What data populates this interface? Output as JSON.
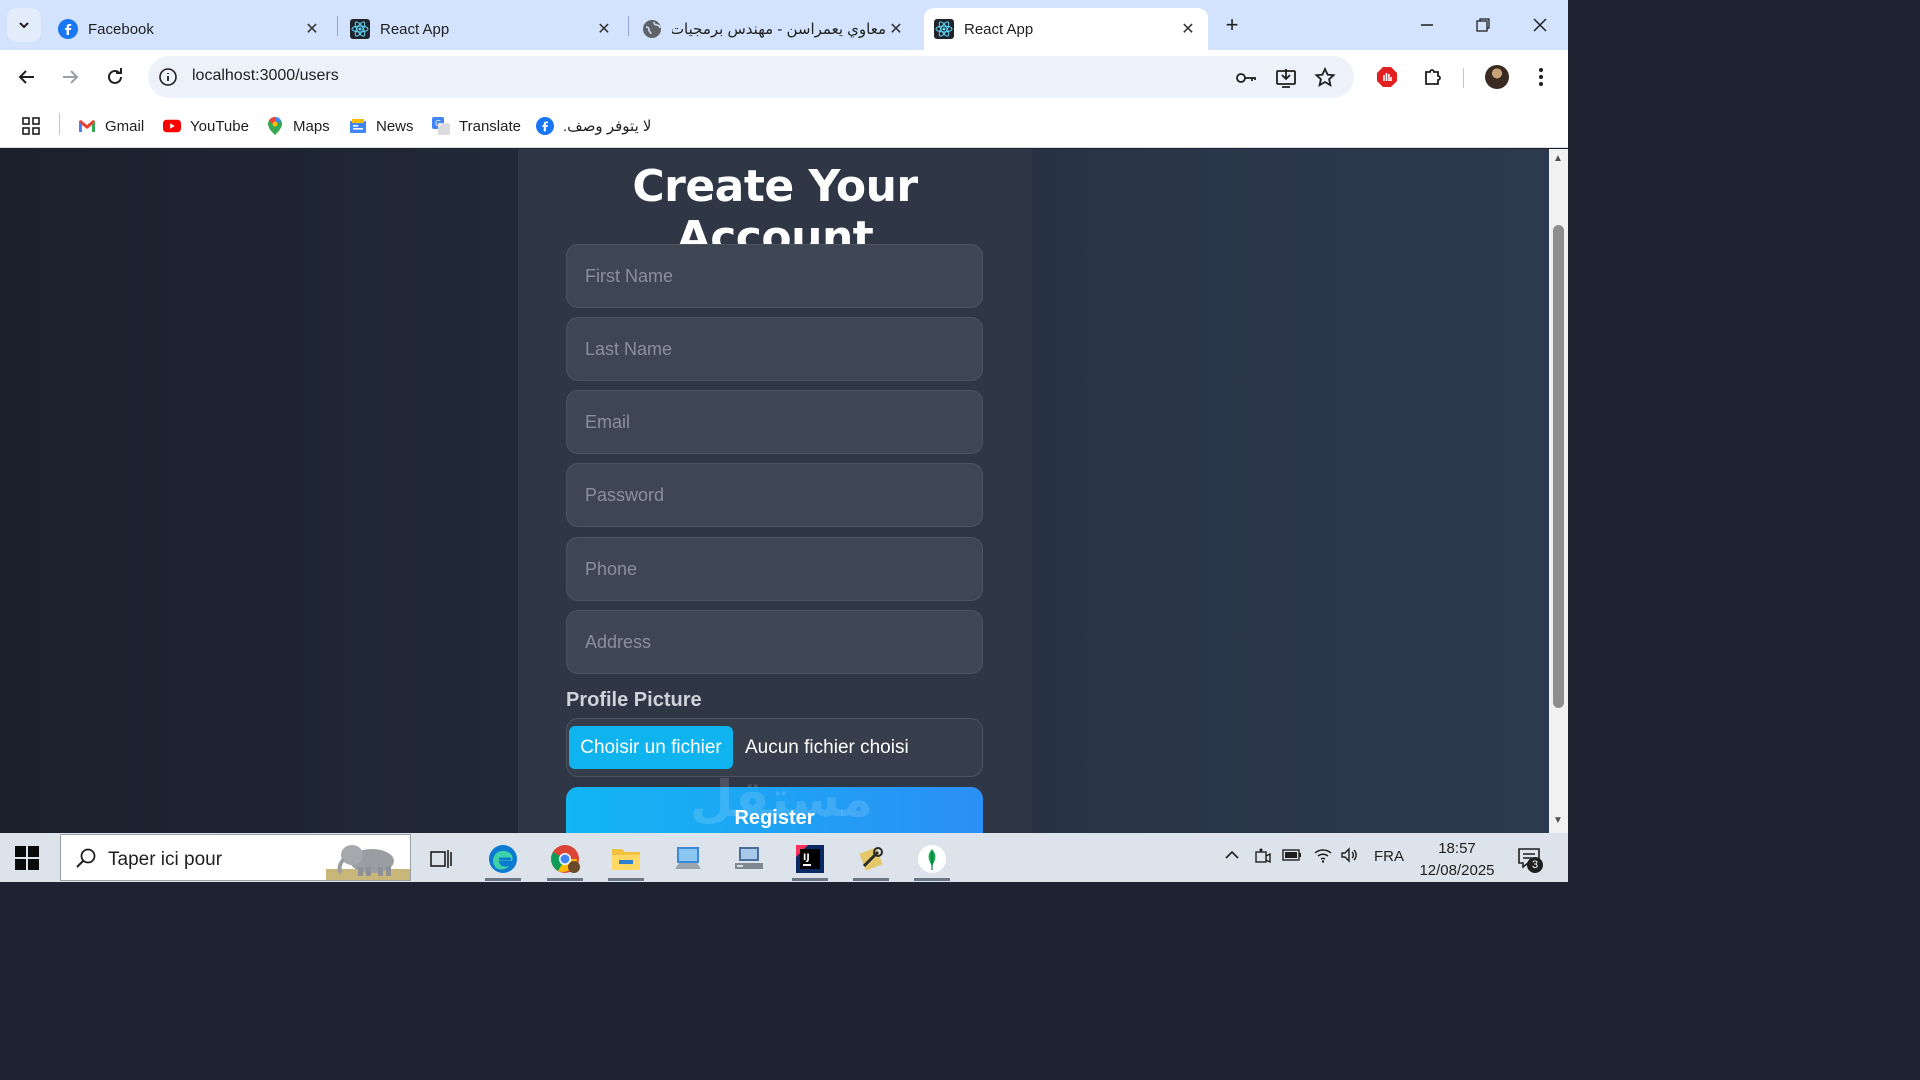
{
  "browser": {
    "tabs": [
      {
        "title": "Facebook",
        "icon": "facebook-icon",
        "active": false
      },
      {
        "title": "React App",
        "icon": "react-icon",
        "active": false
      },
      {
        "title": "معاوي يعمراسن - مهندس برمجيات",
        "icon": "globe-icon",
        "active": false
      },
      {
        "title": "React App",
        "icon": "react-icon",
        "active": true
      }
    ],
    "new_tab_label": "+",
    "url": "localhost:3000/users",
    "bookmarks": [
      {
        "label": "Gmail",
        "icon": "gmail-icon"
      },
      {
        "label": "YouTube",
        "icon": "youtube-icon"
      },
      {
        "label": "Maps",
        "icon": "maps-icon"
      },
      {
        "label": "News",
        "icon": "news-icon"
      },
      {
        "label": "Translate",
        "icon": "translate-icon"
      },
      {
        "label": "لا يتوفر وصف.",
        "icon": "facebook-icon"
      }
    ]
  },
  "form": {
    "title": "Create Your Account",
    "fields": [
      {
        "placeholder": "First Name",
        "value": ""
      },
      {
        "placeholder": "Last Name",
        "value": ""
      },
      {
        "placeholder": "Email",
        "value": ""
      },
      {
        "placeholder": "Password",
        "value": ""
      },
      {
        "placeholder": "Phone",
        "value": ""
      },
      {
        "placeholder": "Address",
        "value": ""
      }
    ],
    "profile_label": "Profile Picture",
    "file_button": "Choisir un fichier",
    "file_status": "Aucun fichier choisi",
    "register_label": "Register",
    "watermark": "مستقل"
  },
  "taskbar": {
    "search_text": "Taper ici pour",
    "language": "FRA",
    "time": "18:57",
    "date": "12/08/2025",
    "notification_count": "3"
  },
  "colors": {
    "accent": "#0fb4ee",
    "card": "#2f3645",
    "field": "#3e4553",
    "tabstrip": "#d3e3fd"
  }
}
